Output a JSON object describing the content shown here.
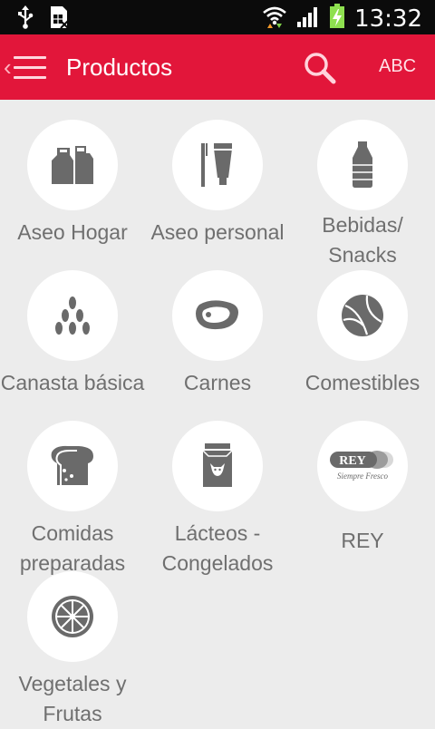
{
  "status_bar": {
    "time": "13:32",
    "icons": [
      "usb-icon",
      "sim-card-icon",
      "wifi-icon",
      "signal-icon",
      "battery-charging-icon"
    ]
  },
  "app_bar": {
    "title": "Productos",
    "abc_label": "ABC",
    "color": "#e2163a",
    "icons": [
      "back-chevron-icon",
      "hamburger-menu-icon",
      "search-icon"
    ]
  },
  "categories": [
    {
      "label": "Aseo Hogar",
      "icon": "cleaning-bottles-icon"
    },
    {
      "label": "Aseo personal",
      "icon": "toothbrush-toothpaste-icon"
    },
    {
      "label": "Bebidas/\nSnacks",
      "icon": "water-bottle-icon"
    },
    {
      "label": "Canasta básica",
      "icon": "grains-icon"
    },
    {
      "label": "Carnes",
      "icon": "steak-icon"
    },
    {
      "label": "Comestibles",
      "icon": "food-ball-icon"
    },
    {
      "label": "Comidas\npreparadas",
      "icon": "bread-icon"
    },
    {
      "label": "Lácteos -\nCongelados",
      "icon": "milk-carton-icon"
    },
    {
      "label": "REY",
      "icon": "rey-logo",
      "logo_text": "REY",
      "logo_tagline": "Siempre Fresco"
    },
    {
      "label": "Vegetales y\nFrutas",
      "icon": "citrus-slice-icon"
    }
  ]
}
